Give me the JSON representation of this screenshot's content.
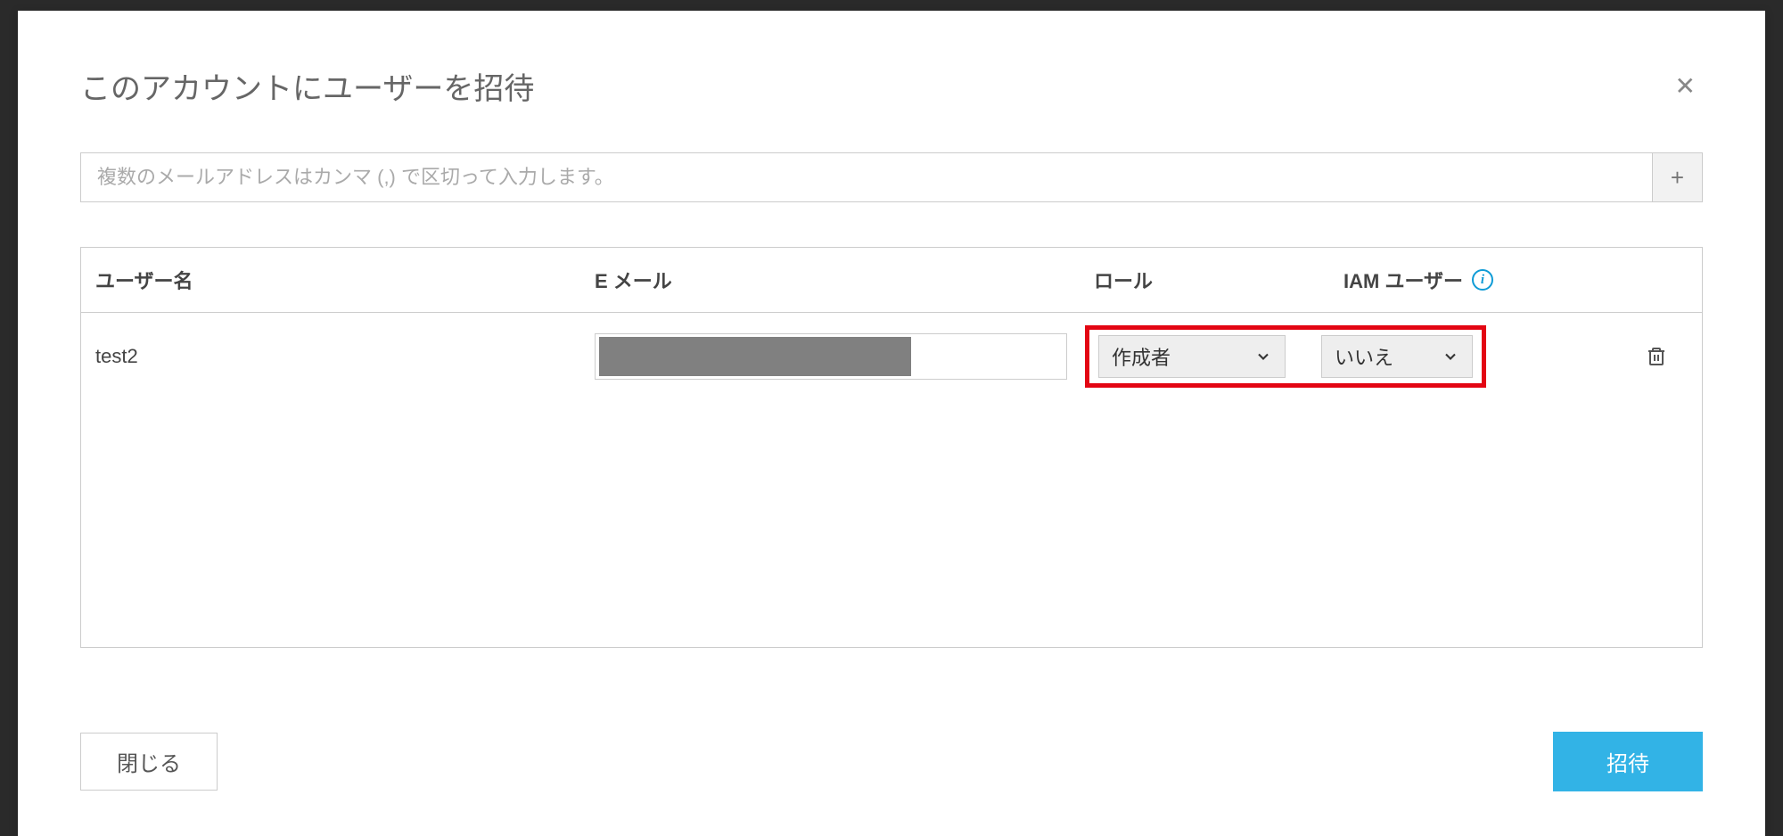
{
  "modal": {
    "title": "このアカウントにユーザーを招待",
    "emailPlaceholder": "複数のメールアドレスはカンマ (,) で区切って入力します。",
    "addLabel": "+",
    "closeLabel": "閉じる",
    "inviteLabel": "招待"
  },
  "columns": {
    "username": "ユーザー名",
    "email": "E メール",
    "role": "ロール",
    "iam": "IAM ユーザー"
  },
  "users": [
    {
      "username": "test2",
      "email": "",
      "role": "作成者",
      "iam": "いいえ"
    }
  ]
}
